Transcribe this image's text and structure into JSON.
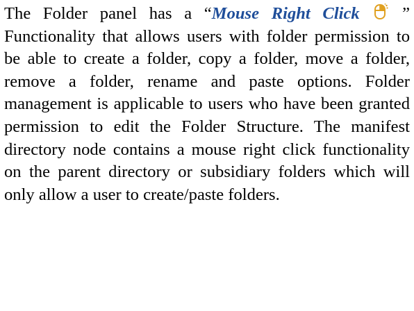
{
  "document": {
    "paragraph": {
      "intro": "The Folder panel has a “",
      "highlight": "Mouse Right Click",
      "after_icon": " ” Functionality that allows users with folder permission to be able to create a folder, copy a folder, move a folder, remove a folder, rename and paste options. Folder management is applicable to users who have been granted permission to edit the Folder Structure. The manifest directory node contains a mouse right click functionality on the parent directory or subsidiary folders which will only allow a user to create/paste folders."
    },
    "icon": {
      "name": "mouse-right-click-icon",
      "stroke_color": "#E0A020",
      "highlight_color": "#E0A020"
    },
    "colors": {
      "text": "#000000",
      "highlight": "#1F4E9A"
    }
  }
}
